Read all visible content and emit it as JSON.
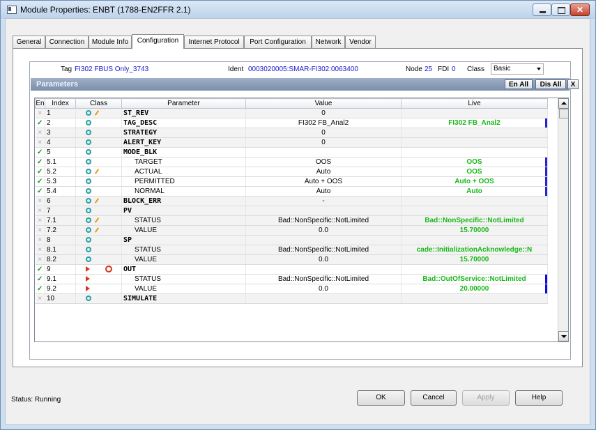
{
  "window": {
    "title": "Module Properties: ENBT (1788-EN2FFR 2.1)"
  },
  "tabs": [
    {
      "label": "General"
    },
    {
      "label": "Connection"
    },
    {
      "label": "Module Info"
    },
    {
      "label": "Configuration"
    },
    {
      "label": "Internet Protocol"
    },
    {
      "label": "Port Configuration"
    },
    {
      "label": "Network"
    },
    {
      "label": "Vendor"
    }
  ],
  "info": {
    "tag_label": "Tag",
    "tag_value": "FI302 FBUS Only_3743",
    "ident_label": "Ident",
    "ident_value": "0003020005:SMAR-FI302:0063400",
    "node_label": "Node",
    "node_value": "25",
    "fdi_label": "FDI",
    "fdi_value": "0",
    "class_label": "Class",
    "class_value": "Basic"
  },
  "params": {
    "title": "Parameters",
    "en_all": "En All",
    "dis_all": "Dis All",
    "close": "X",
    "columns": [
      "En",
      "Index",
      "Class",
      "Parameter",
      "Value",
      "Live"
    ],
    "rows": [
      {
        "en": "×",
        "idx": "1",
        "cls": "dot",
        "flag": "pencil",
        "param": "ST_REV",
        "sub": false,
        "value": "0",
        "live": "",
        "mark": ""
      },
      {
        "en": "✓",
        "idx": "2",
        "cls": "dot",
        "flag": "",
        "param": "TAG_DESC",
        "sub": false,
        "value": "FI302 FB_Anal2",
        "live": "FI302 FB_Anal2",
        "mark": "blue"
      },
      {
        "en": "×",
        "idx": "3",
        "cls": "dot",
        "flag": "",
        "param": "STRATEGY",
        "sub": false,
        "value": "0",
        "live": "",
        "mark": ""
      },
      {
        "en": "×",
        "idx": "4",
        "cls": "dot",
        "flag": "",
        "param": "ALERT_KEY",
        "sub": false,
        "value": "0",
        "live": "",
        "mark": ""
      },
      {
        "en": "✓",
        "idx": "5",
        "cls": "dot",
        "flag": "",
        "param": "MODE_BLK",
        "sub": false,
        "value": "",
        "live": "",
        "mark": ""
      },
      {
        "en": "✓",
        "idx": "5.1",
        "cls": "dot",
        "flag": "",
        "param": "TARGET",
        "sub": true,
        "value": "OOS",
        "live": "OOS",
        "mark": "blue"
      },
      {
        "en": "✓",
        "idx": "5.2",
        "cls": "dot",
        "flag": "pencil",
        "param": "ACTUAL",
        "sub": true,
        "value": "Auto",
        "live": "OOS",
        "mark": "blue"
      },
      {
        "en": "✓",
        "idx": "5.3",
        "cls": "dot",
        "flag": "",
        "param": "PERMITTED",
        "sub": true,
        "value": "Auto + OOS",
        "live": "Auto + OOS",
        "mark": "blue"
      },
      {
        "en": "✓",
        "idx": "5.4",
        "cls": "dot",
        "flag": "",
        "param": "NORMAL",
        "sub": true,
        "value": "Auto",
        "live": "Auto",
        "mark": "blue"
      },
      {
        "en": "×",
        "idx": "6",
        "cls": "dot",
        "flag": "pencil",
        "param": "BLOCK_ERR",
        "sub": false,
        "value": "-",
        "live": "",
        "mark": ""
      },
      {
        "en": "×",
        "idx": "7",
        "cls": "dot",
        "flag": "",
        "param": "PV",
        "sub": false,
        "value": "",
        "live": "",
        "mark": ""
      },
      {
        "en": "×",
        "idx": "7.1",
        "cls": "dot",
        "flag": "pencil",
        "param": "STATUS",
        "sub": true,
        "value": "Bad::NonSpecific::NotLimited",
        "live": "Bad::NonSpecific::NotLimited",
        "mark": ""
      },
      {
        "en": "×",
        "idx": "7.2",
        "cls": "dot",
        "flag": "pencil",
        "param": "VALUE",
        "sub": true,
        "value": "0.0",
        "live": "15.70000",
        "mark": ""
      },
      {
        "en": "×",
        "idx": "8",
        "cls": "dot",
        "flag": "",
        "param": "SP",
        "sub": false,
        "value": "",
        "live": "",
        "mark": ""
      },
      {
        "en": "×",
        "idx": "8.1",
        "cls": "dot",
        "flag": "",
        "param": "STATUS",
        "sub": true,
        "value": "Bad::NonSpecific::NotLimited",
        "live": "cade::InitializationAcknowledge::N",
        "mark": ""
      },
      {
        "en": "×",
        "idx": "8.2",
        "cls": "dot",
        "flag": "",
        "param": "VALUE",
        "sub": true,
        "value": "0.0",
        "live": "15.70000",
        "mark": ""
      },
      {
        "en": "✓",
        "idx": "9",
        "cls": "arrow",
        "flag": "ring",
        "param": "OUT",
        "sub": false,
        "value": "",
        "live": "",
        "mark": ""
      },
      {
        "en": "✓",
        "idx": "9.1",
        "cls": "arrow",
        "flag": "",
        "param": "STATUS",
        "sub": true,
        "value": "Bad::NonSpecific::NotLimited",
        "live": "Bad::OutOfService::NotLimited",
        "mark": "strong"
      },
      {
        "en": "✓",
        "idx": "9.2",
        "cls": "arrow",
        "flag": "",
        "param": "VALUE",
        "sub": true,
        "value": "0.0",
        "live": "20.00000",
        "mark": "strong"
      },
      {
        "en": "×",
        "idx": "10",
        "cls": "dot",
        "flag": "",
        "param": "SIMULATE",
        "sub": false,
        "value": "",
        "live": "",
        "mark": ""
      }
    ]
  },
  "status": {
    "label": "Status:",
    "value": "Running"
  },
  "buttons": {
    "ok": "OK",
    "cancel": "Cancel",
    "apply": "Apply",
    "help": "Help"
  },
  "colors": {
    "live_text": "#18b818",
    "info_value": "#1717c8",
    "check": "#1d8f1d",
    "header": "#8a9cb6"
  }
}
